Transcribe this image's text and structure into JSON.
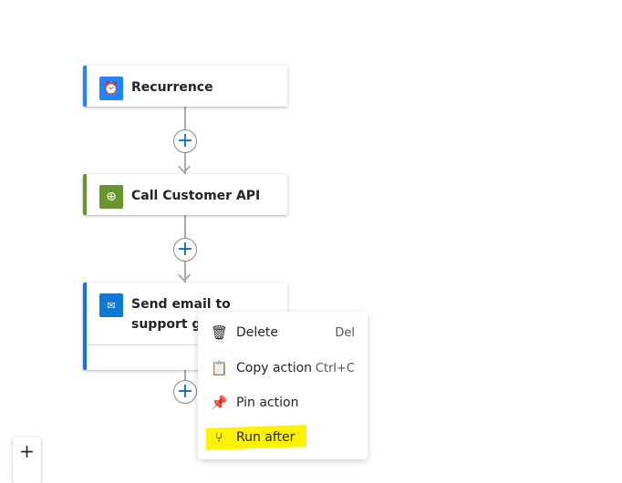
{
  "cards": [
    {
      "title": "Recurrence",
      "icon": "alarm-clock-icon",
      "color": "#1f85ff"
    },
    {
      "title": "Call Customer API",
      "icon": "globe-icon",
      "color": "#6a942e"
    },
    {
      "title": "Send email to support group",
      "icon": "outlook-icon",
      "color": "#0f78d4"
    }
  ],
  "context_menu": {
    "items": [
      {
        "label": "Delete",
        "shortcut": "Del",
        "icon": "trash-icon"
      },
      {
        "label": "Copy action",
        "shortcut": "Ctrl+C",
        "icon": "clipboard-icon"
      },
      {
        "label": "Pin action",
        "shortcut": "",
        "icon": "pin-icon"
      },
      {
        "label": "Run after",
        "shortcut": "",
        "icon": "branch-icon",
        "highlighted": true
      }
    ]
  },
  "zoom_controls": {
    "zoom_in": "+"
  },
  "plus": "+"
}
